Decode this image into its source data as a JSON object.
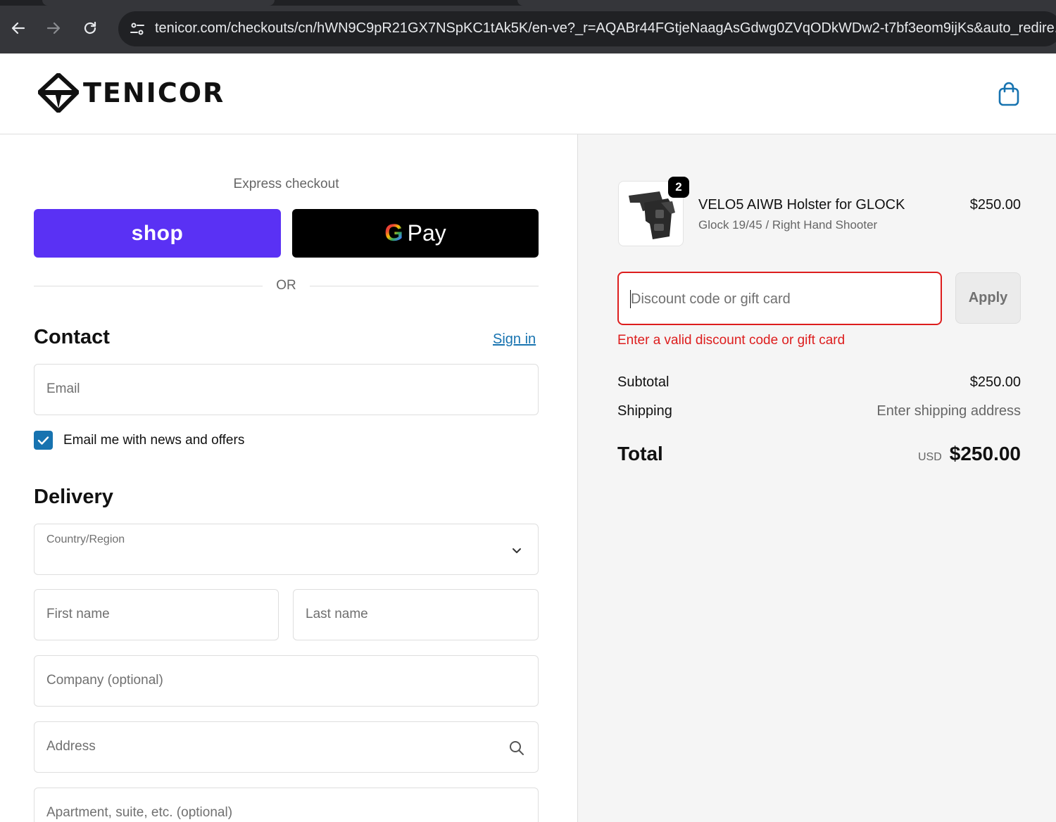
{
  "browser": {
    "url": "tenicor.com/checkouts/cn/hWN9C9pR21GX7NSpKC1tAk5K/en-ve?_r=AQABr44FGtjeNaagAsGdwg0ZVqODkWDw2-t7bf3eom9ijKs&auto_redire..."
  },
  "header": {
    "brand": "TENICOR"
  },
  "checkout": {
    "express_label": "Express checkout",
    "shop_label": "shop",
    "gpay_g": "G",
    "gpay_label": "Pay",
    "or_label": "OR",
    "contact": {
      "title": "Contact",
      "signin": "Sign in",
      "email_placeholder": "Email",
      "newsletter_label": "Email me with news and offers",
      "newsletter_checked": true
    },
    "delivery": {
      "title": "Delivery",
      "country_label": "Country/Region",
      "first_name_placeholder": "First name",
      "last_name_placeholder": "Last name",
      "company_placeholder": "Company (optional)",
      "address_placeholder": "Address",
      "apartment_placeholder": "Apartment, suite, etc. (optional)"
    }
  },
  "summary": {
    "item": {
      "quantity": "2",
      "name": "VELO5 AIWB Holster for GLOCK",
      "variant": "Glock 19/45 / Right Hand Shooter",
      "price": "$250.00"
    },
    "discount": {
      "placeholder": "Discount code or gift card",
      "apply_label": "Apply",
      "error": "Enter a valid discount code or gift card"
    },
    "subtotal_label": "Subtotal",
    "subtotal_value": "$250.00",
    "shipping_label": "Shipping",
    "shipping_value": "Enter shipping address",
    "total_label": "Total",
    "total_currency": "USD",
    "total_value": "$250.00"
  },
  "colors": {
    "shop_purple": "#5a31f4",
    "link_blue": "#1773b0",
    "error_red": "#dd1d1d"
  }
}
